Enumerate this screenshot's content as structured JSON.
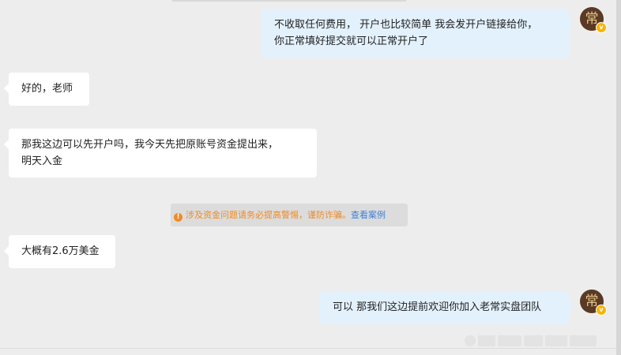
{
  "messages": [
    {
      "direction": "out",
      "lines": [
        "不收取任何费用， 开户也比较简单 我会发开户链接给你，",
        "你正常填好提交就可以正常开户了"
      ]
    },
    {
      "direction": "in",
      "lines": [
        "好的，老师"
      ]
    },
    {
      "direction": "in",
      "lines": [
        "那我这边可以先开户吗，我今天先把原账号资金提出来，",
        "明天入金"
      ]
    },
    {
      "direction": "in",
      "lines": [
        "大概有2.6万美金"
      ]
    },
    {
      "direction": "out",
      "lines": [
        "可以 那我们这边提前欢迎你加入老常实盘团队"
      ]
    }
  ],
  "avatar": {
    "glyph": "常",
    "badge": "v",
    "badge_color": "#f7b500"
  },
  "notice": {
    "icon": "warning-info-icon",
    "text": "涉及资金问题请务必提高警惕，谨防诈骗。",
    "link_text": "查看案例",
    "text_color": "#f08a24",
    "link_color": "#3d7fd6"
  },
  "colors": {
    "background": "#ededed",
    "incoming_bubble": "#ffffff",
    "outgoing_bubble": "#e3f1fd"
  }
}
